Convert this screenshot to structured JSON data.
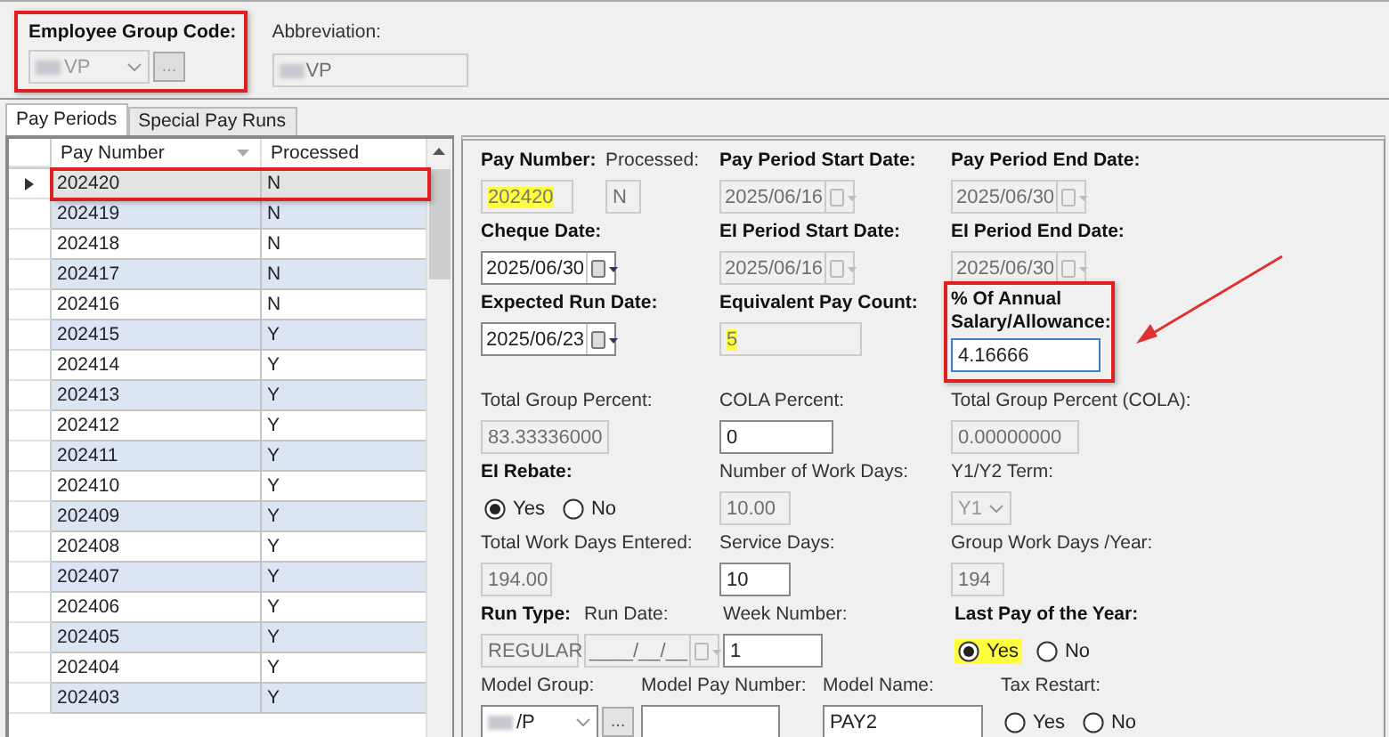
{
  "group_code": {
    "label": "Employee Group Code:",
    "value": "VP",
    "redacted": true,
    "button": "...",
    "disabled": true,
    "annotated": true
  },
  "abbreviation": {
    "label": "Abbreviation:",
    "value": "VP",
    "redacted": true
  },
  "tabs": [
    {
      "label": "Pay Periods",
      "selected": true
    },
    {
      "label": "Special Pay Runs",
      "selected": false
    }
  ],
  "grid": {
    "columns": [
      {
        "label": "Pay Number",
        "sorted": true
      },
      {
        "label": "Processed",
        "sorted": false
      }
    ],
    "rows": [
      {
        "pay_number": "202420",
        "processed": "N",
        "selected": true,
        "annotated": true
      },
      {
        "pay_number": "202419",
        "processed": "N",
        "selected": false,
        "annotated": false
      },
      {
        "pay_number": "202418",
        "processed": "N",
        "selected": false,
        "annotated": false
      },
      {
        "pay_number": "202417",
        "processed": "N",
        "selected": false,
        "annotated": false
      },
      {
        "pay_number": "202416",
        "processed": "N",
        "selected": false,
        "annotated": false
      },
      {
        "pay_number": "202415",
        "processed": "Y",
        "selected": false,
        "annotated": false
      },
      {
        "pay_number": "202414",
        "processed": "Y",
        "selected": false,
        "annotated": false
      },
      {
        "pay_number": "202413",
        "processed": "Y",
        "selected": false,
        "annotated": false
      },
      {
        "pay_number": "202412",
        "processed": "Y",
        "selected": false,
        "annotated": false
      },
      {
        "pay_number": "202411",
        "processed": "Y",
        "selected": false,
        "annotated": false
      },
      {
        "pay_number": "202410",
        "processed": "Y",
        "selected": false,
        "annotated": false
      },
      {
        "pay_number": "202409",
        "processed": "Y",
        "selected": false,
        "annotated": false
      },
      {
        "pay_number": "202408",
        "processed": "Y",
        "selected": false,
        "annotated": false
      },
      {
        "pay_number": "202407",
        "processed": "Y",
        "selected": false,
        "annotated": false
      },
      {
        "pay_number": "202406",
        "processed": "Y",
        "selected": false,
        "annotated": false
      },
      {
        "pay_number": "202405",
        "processed": "Y",
        "selected": false,
        "annotated": false
      },
      {
        "pay_number": "202404",
        "processed": "Y",
        "selected": false,
        "annotated": false
      },
      {
        "pay_number": "202403",
        "processed": "Y",
        "selected": false,
        "annotated": false
      }
    ]
  },
  "form": {
    "rows": [
      [
        {
          "kind": "text",
          "label": "Pay Number:",
          "required": true,
          "value": "202420",
          "disabled": true,
          "highlighted": true
        },
        {
          "kind": "text",
          "label": "Processed:",
          "required": false,
          "value": "N",
          "disabled": true
        },
        {
          "kind": "date",
          "label": "Pay Period Start Date:",
          "required": true,
          "value": "2025/06/16",
          "disabled": true
        },
        {
          "kind": "date",
          "label": "Pay Period End Date:",
          "required": true,
          "value": "2025/06/30",
          "disabled": true
        }
      ],
      [
        {
          "kind": "date",
          "label": "Cheque Date:",
          "required": true,
          "value": "2025/06/30",
          "disabled": false
        },
        {
          "kind": "date",
          "label": "EI Period Start Date:",
          "required": true,
          "value": "2025/06/16",
          "disabled": true
        },
        {
          "kind": "date",
          "label": "EI Period End Date:",
          "required": true,
          "value": "2025/06/30",
          "disabled": true
        }
      ],
      [
        {
          "kind": "date",
          "label": "Expected Run Date:",
          "required": true,
          "value": "2025/06/23",
          "disabled": false
        },
        {
          "kind": "text",
          "label": "Equivalent Pay Count:",
          "required": true,
          "value": "5",
          "disabled": true,
          "highlighted": true
        },
        {
          "kind": "text",
          "label": "% Of Annual Salary/Allowance:",
          "required": true,
          "value": "4.16666",
          "disabled": false,
          "focused": true,
          "annotated": true
        }
      ],
      [
        {
          "kind": "text",
          "label": "Total Group Percent:",
          "required": false,
          "value": "83.33336000",
          "disabled": true
        },
        {
          "kind": "text",
          "label": "COLA Percent:",
          "required": false,
          "value": "0",
          "disabled": false
        },
        {
          "kind": "text",
          "label": "Total Group Percent (COLA):",
          "required": false,
          "value": "0.00000000",
          "disabled": true
        }
      ],
      [
        {
          "kind": "radio",
          "label": "EI Rebate:",
          "required": true,
          "options": [
            {
              "label": "Yes",
              "selected": true,
              "highlighted": false
            },
            {
              "label": "No",
              "selected": false,
              "highlighted": false
            }
          ]
        },
        {
          "kind": "text",
          "label": "Number of Work Days:",
          "required": false,
          "value": "10.00",
          "disabled": true
        },
        {
          "kind": "combo",
          "label": "Y1/Y2 Term:",
          "required": false,
          "value": "Y1",
          "disabled": true
        }
      ],
      [
        {
          "kind": "text",
          "label": "Total Work Days Entered:",
          "required": false,
          "value": "194.00",
          "disabled": true
        },
        {
          "kind": "text",
          "label": "Service Days:",
          "required": false,
          "value": "10",
          "disabled": false
        },
        {
          "kind": "text",
          "label": "Group Work Days /Year:",
          "required": false,
          "value": "194",
          "disabled": true
        }
      ],
      [
        {
          "kind": "text",
          "label": "Run Type:",
          "required": true,
          "value": "REGULAR",
          "disabled": true
        },
        {
          "kind": "date",
          "label": "Run Date:",
          "required": false,
          "value": "____/__/__",
          "disabled": true
        },
        {
          "kind": "text",
          "label": "Week Number:",
          "required": false,
          "value": "1",
          "disabled": false
        },
        {
          "kind": "radio",
          "label": "Last Pay of the Year:",
          "required": true,
          "options": [
            {
              "label": "Yes",
              "selected": true,
              "highlighted": true
            },
            {
              "label": "No",
              "selected": false,
              "highlighted": false
            }
          ]
        }
      ],
      [
        {
          "kind": "combo",
          "label": "Model Group:",
          "required": false,
          "value": "/P",
          "redacted": true,
          "button": "...",
          "disabled": false
        },
        {
          "kind": "text",
          "label": "Model Pay Number:",
          "required": false,
          "disabled": false
        },
        {
          "kind": "text",
          "label": "Model Name:",
          "required": false,
          "value": "PAY2",
          "disabled": false
        },
        {
          "kind": "radio",
          "label": "Tax Restart:",
          "required": false,
          "options": [
            {
              "label": "Yes",
              "selected": false,
              "highlighted": false
            },
            {
              "label": "No",
              "selected": false,
              "highlighted": false
            }
          ]
        }
      ]
    ]
  }
}
